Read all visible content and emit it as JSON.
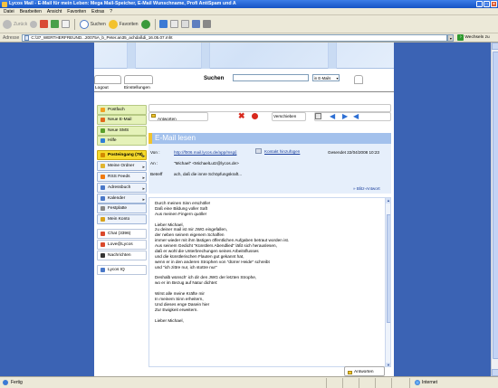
{
  "window": {
    "title": "Lycos Mail - E-Mail für mein Leben: Mega Mail-Speicher, E-Mail Wunschname, Profi AntiSpam und A"
  },
  "menu": [
    "Datei",
    "Bearbeiten",
    "Ansicht",
    "Favoriten",
    "Extras",
    "?"
  ],
  "toolbar": {
    "back": "Zurück",
    "search": "Suchen",
    "favorites": "Favoriten"
  },
  "address": {
    "label": "Adresse",
    "url": "C:\\37_WERTHERFREUND...20075A_b_Peter.an35_achdaßdi_16.05.07.mht",
    "go": "Wechseln zu"
  },
  "header": {
    "search_label": "Suchen",
    "search_scope": "in E-Mails",
    "logout": "Logout",
    "settings": "Einstellungen"
  },
  "nav": [
    {
      "label": "Postfach",
      "style": "lime",
      "icon_color": "#f0a020",
      "icon": "mailbox-icon"
    },
    {
      "label": "Neue E-Mail",
      "style": "lime",
      "icon_color": "#e06a1c",
      "icon": "compose-icon"
    },
    {
      "label": "Neue SMS",
      "style": "lime",
      "icon_color": "#5aa02c",
      "icon": "sms-icon"
    },
    {
      "label": "Hilfe",
      "style": "lime",
      "icon_color": "#2f7fd6",
      "icon": "help-icon"
    },
    {
      "label": "Posteingang (78)",
      "style": "yellow",
      "icon_color": "#d28a00",
      "icon": "inbox-icon",
      "arrow": true
    },
    {
      "label": "Meine Ordner",
      "style": "normal",
      "icon_color": "#e0b430",
      "icon": "folder-icon",
      "arrow": true
    },
    {
      "label": "RSS Feeds",
      "style": "normal",
      "icon_color": "#f07a10",
      "icon": "rss-icon",
      "arrow": true
    },
    {
      "label": "Adressbuch",
      "style": "normal",
      "icon_color": "#4a78c8",
      "icon": "addressbook-icon",
      "arrow": true
    },
    {
      "label": "Kalender",
      "style": "normal",
      "icon_color": "#4a78c8",
      "icon": "calendar-icon",
      "arrow": true
    },
    {
      "label": "Festplatte",
      "style": "normal",
      "icon_color": "#888888",
      "icon": "harddisk-icon"
    },
    {
      "label": "Mein Konto",
      "style": "normal",
      "icon_color": "#d9a21b",
      "icon": "account-icon"
    },
    {
      "label": "Chat (3396)",
      "style": "plain",
      "icon_color": "#d9482c",
      "icon": "chat-icon"
    },
    {
      "label": "Love@Lycos",
      "style": "plain",
      "icon_color": "#d9482c",
      "icon": "love-icon"
    },
    {
      "label": "Nachrichten",
      "style": "plain",
      "icon_color": "#333333",
      "icon": "news-icon"
    },
    {
      "label": "Lycos IQ",
      "style": "plain",
      "icon_color": "#4a78c8",
      "icon": "lycos-iq-icon"
    }
  ],
  "message_toolbar": {
    "reply": "Antworten",
    "forward": "Verschieben"
  },
  "message": {
    "heading": "E-Mail lesen",
    "from_label": "Von :",
    "from_value": "http://f006.mail.lycos.de/app/msg/j",
    "add_contact": "Kontakt hinzufügen",
    "sent": "Gesendet 22/04/2008 10:23",
    "to_label": "An :",
    "to_value": "\"Michael\" <MichaelLutz@lycos.de>",
    "subject_label": "Betreff",
    "subject_value": "ach, daß die innre Schöpfungskraft...",
    "quick_reply": "» Blitz-Antwort",
    "body_lines": [
      "Durch meinen Sinn erschölle!",
      "Daß eine Bildung voller Saft",
      "Aus meinen Fingern quölle!",
      "",
      "Lieber Michael,",
      "zu deiner mail ist mir JWG eingefallen,",
      "der neben seinem eigenem Schaffen",
      "immer wieder mit ihm lästigen öffentlichen Aufgaben betraut worden ist.",
      "Aus seinem Gedicht \"Künstlers Abendlied\" läßt sich herauslesen,",
      "daß er wohl die Unterbrechungen seines Arbeitsflusses",
      "und die künstlerischen Flauten gut gekannt hat,",
      "wenn er in den anderen Strophen von \"dürrer Heide\" schreibt",
      "und \"ich zittre nur, ich stottre nur\"",
      "",
      "Deshalb wünsch' ich dir den JWG der letzten Strophe,",
      "wo er im Bezug auf Natur dichtet:",
      "",
      "Wirst alle meine Kräfte mir",
      "In meinem Sinn erheitern,",
      "Und dieses enge Dasein hier",
      "Zur Ewigkeit erweitern.",
      "",
      "Lieber Michael,"
    ],
    "bottom_reply": "Antworten"
  },
  "status": {
    "text": "Fertig",
    "zone": "Internet"
  }
}
